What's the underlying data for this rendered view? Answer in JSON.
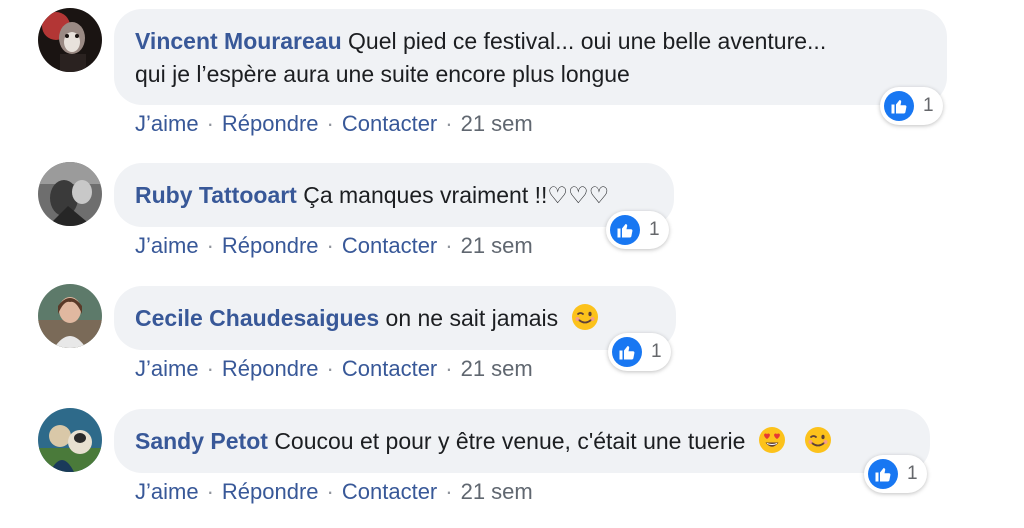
{
  "colors": {
    "author_link": "#385898",
    "bubble_bg": "#f0f2f5",
    "like_blue": "#1877f2",
    "meta_gray": "#606770"
  },
  "action_labels": {
    "like": "J’aime",
    "reply": "Répondre",
    "contact": "Contacter",
    "separator": "·"
  },
  "comments": [
    {
      "author": "Vincent Mourareau",
      "text_line1": "Quel pied ce festival... oui une belle aventure...",
      "text_line2": "qui je l’espère aura une suite encore plus longue",
      "reaction_icon": "thumbs-up-icon",
      "reaction_count": "1",
      "time": "21 sem"
    },
    {
      "author": "Ruby Tattooart",
      "text": "Ça manques vraiment !!♡♡♡",
      "reaction_icon": "thumbs-up-icon",
      "reaction_count": "1",
      "time": "21 sem"
    },
    {
      "author": "Cecile Chaudesaigues",
      "text": "on ne sait jamais",
      "emojis": [
        "winking-face-icon"
      ],
      "reaction_icon": "thumbs-up-icon",
      "reaction_count": "1",
      "time": "21 sem"
    },
    {
      "author": "Sandy Petot",
      "text": "Coucou et pour y être venue, c'était une tuerie",
      "emojis": [
        "heart-eyes-face-icon",
        "winking-face-icon"
      ],
      "reaction_icon": "thumbs-up-icon",
      "reaction_count": "1",
      "time": "21 sem"
    }
  ]
}
